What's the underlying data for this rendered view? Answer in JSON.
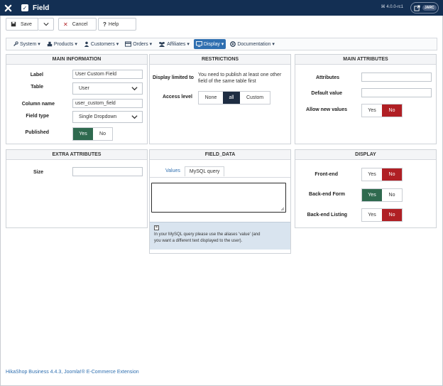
{
  "header": {
    "title": "Field",
    "version": "⌘ 4.0.0-rc1",
    "user_badge": "JARC"
  },
  "toolbar": {
    "save_label": "Save",
    "cancel_label": "Cancel",
    "help_label": "Help"
  },
  "menu": {
    "system": "System",
    "products": "Products",
    "customers": "Customers",
    "orders": "Orders",
    "affiliates": "Affiliates",
    "display": "Display",
    "documentation": "Documentation"
  },
  "main_information": {
    "heading": "MAIN INFORMATION",
    "label_label": "Label",
    "label_value": "User Custom Field",
    "table_label": "Table",
    "table_value": "User",
    "column_label": "Column name",
    "column_value": "user_custom_field",
    "fieldtype_label": "Field type",
    "fieldtype_value": "Single Dropdown",
    "published_label": "Published",
    "yes": "Yes",
    "no": "No"
  },
  "restrictions": {
    "heading": "RESTRICTIONS",
    "display_label": "Display limited to",
    "display_note": "You need to publish at least one other field of the same table first",
    "access_label": "Access level",
    "access_none": "None",
    "access_all": "all",
    "access_custom": "Custom"
  },
  "main_attributes": {
    "heading": "MAIN ATTRIBUTES",
    "attributes_label": "Attributes",
    "default_label": "Default value",
    "allow_label": "Allow new values",
    "yes": "Yes",
    "no": "No"
  },
  "extra_attributes": {
    "heading": "EXTRA ATTRIBUTES",
    "size_label": "Size"
  },
  "field_data": {
    "heading": "FIELD_DATA",
    "tab_values": "Values",
    "tab_mysql": "MySQL query",
    "info_line1": "In your MySQL query please use the aliases 'value' (and",
    "info_line2": "you want a different text displayed to the user)."
  },
  "display": {
    "heading": "DISPLAY",
    "frontend_label": "Front-end",
    "backend_form_label": "Back-end Form",
    "backend_listing_label": "Back-end Listing",
    "yes": "Yes",
    "no": "No"
  },
  "footer": {
    "text": "HikaShop Business 4.4.3, Joomla!® E-Commerce Extension"
  }
}
